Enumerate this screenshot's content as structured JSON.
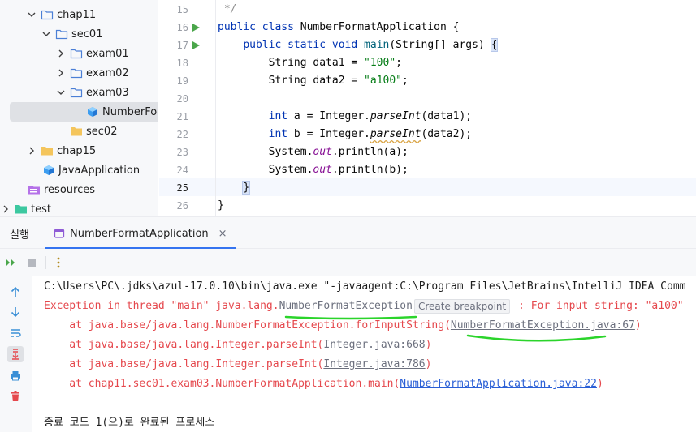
{
  "tree": {
    "items": [
      {
        "label": "chap11",
        "expanded": true,
        "icon": "folder-icon"
      },
      {
        "label": "sec01",
        "expanded": true,
        "icon": "folder-icon"
      },
      {
        "label": "exam01",
        "expanded": false,
        "icon": "folder-icon"
      },
      {
        "label": "exam02",
        "expanded": false,
        "icon": "folder-icon"
      },
      {
        "label": "exam03",
        "expanded": true,
        "icon": "folder-icon"
      },
      {
        "label": "NumberFor",
        "icon": "java-class-icon",
        "selected": true
      },
      {
        "label": "sec02",
        "icon": "folder-icon"
      },
      {
        "label": "chap15",
        "expanded": false,
        "icon": "folder-icon"
      },
      {
        "label": "JavaApplication",
        "icon": "java-class-icon"
      },
      {
        "label": "resources",
        "icon": "resources-folder-icon"
      },
      {
        "label": "test",
        "expanded": false,
        "icon": "test-folder-icon"
      }
    ]
  },
  "editor": {
    "line_numbers": [
      "15",
      "16",
      "17",
      "18",
      "19",
      "20",
      "21",
      "22",
      "23",
      "24",
      "25",
      "26"
    ],
    "lines": {
      "l15": " */",
      "l16_kw1": "public",
      "l16_kw2": "class",
      "l16_rest": " NumberFormatApplication {",
      "l17_kw1": "public",
      "l17_kw2": "static",
      "l17_kw3": "void",
      "l17_fn": "main",
      "l17_rest": "(String[] args) ",
      "l17_brace": "{",
      "l18_a": "String data1 = ",
      "l18_str": "\"100\"",
      "l18_b": ";",
      "l19_a": "String data2 = ",
      "l19_str": "\"a100\"",
      "l19_b": ";",
      "l21_kw": "int",
      "l21_a": " a = Integer.",
      "l21_m": "parseInt",
      "l21_b": "(data1);",
      "l22_kw": "int",
      "l22_a": " b = Integer.",
      "l22_m": "parseInt",
      "l22_b": "(data2);",
      "l23_a": "System.",
      "l23_f": "out",
      "l23_b": ".println(a);",
      "l24_a": "System.",
      "l24_f": "out",
      "l24_b": ".println(b);",
      "l25": "}",
      "l26": "}"
    }
  },
  "tool_window": {
    "title": "실행",
    "tab_label": "NumberFormatApplication",
    "tab_close": "×"
  },
  "console": {
    "line1": "C:\\Users\\PC\\.jdks\\azul-17.0.10\\bin\\java.exe \"-javaagent:C:\\Program Files\\JetBrains\\IntelliJ IDEA Comm",
    "line2_a": "Exception in thread \"main\" java.lang.",
    "line2_link": "NumberFormatException",
    "line2_chip": "Create breakpoint",
    "line2_b": " : For input string: \"a100\"",
    "line3_a": "    at java.base/java.lang.NumberFormatException.forInputString(",
    "line3_link": "NumberFormatException.java:67",
    "line3_b": ")",
    "line4_a": "    at java.base/java.lang.Integer.parseInt(",
    "line4_link": "Integer.java:668",
    "line4_b": ")",
    "line5_a": "    at java.base/java.lang.Integer.parseInt(",
    "line5_link": "Integer.java:786",
    "line5_b": ")",
    "line6_a": "    at chap11.sec01.exam03.NumberFormatApplication.main(",
    "line6_link": "NumberFormatApplication.java:22",
    "line6_b": ")",
    "line8": "종료 코드 1(으)로 완료된 프로세스"
  },
  "colors": {
    "accent": "#3574f0",
    "error_text": "#e5484d",
    "annotation_green": "#2bd42b",
    "run_green": "#4aa64a"
  }
}
